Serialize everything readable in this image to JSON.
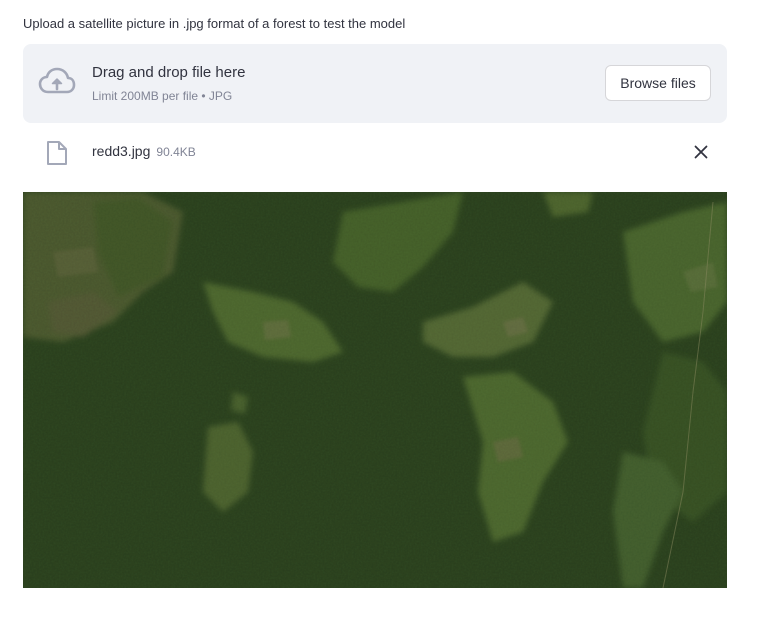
{
  "uploader": {
    "label": "Upload a satellite picture in .jpg format of a forest to test the model",
    "dropzone_title": "Drag and drop file here",
    "dropzone_limit": "Limit 200MB per file • JPG",
    "browse_button": "Browse files",
    "icon": "cloud-upload-icon"
  },
  "uploaded_file": {
    "name": "redd3.jpg",
    "size": "90.4KB",
    "icon": "file-icon",
    "remove_icon": "close-icon"
  },
  "image": {
    "description_icon": "satellite-forest-image"
  },
  "colors": {
    "accent": "#a3a8b8",
    "dropzone_bg": "#f0f2f6",
    "text": "#31333f",
    "muted_text": "#808495"
  }
}
